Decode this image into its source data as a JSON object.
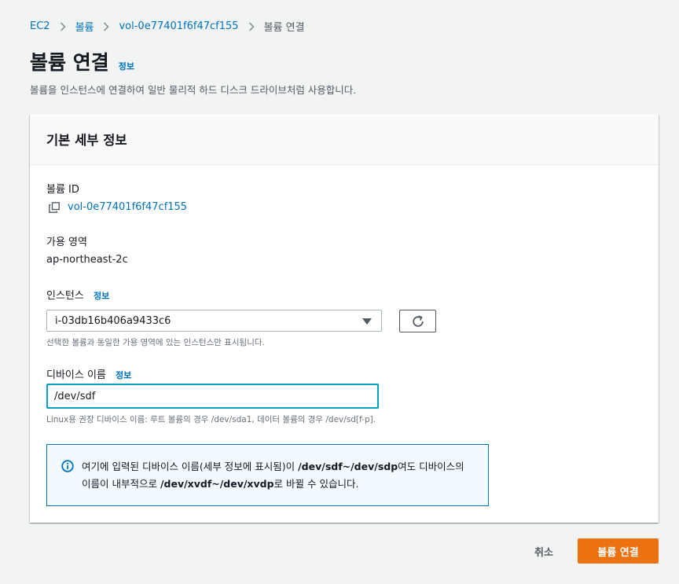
{
  "breadcrumb": {
    "items": [
      "EC2",
      "볼륨",
      "vol-0e77401f6f47cf155"
    ],
    "current": "볼륨 연결"
  },
  "page": {
    "title": "볼륨 연결",
    "info_link": "정보",
    "subtitle": "볼륨을 인스턴스에 연결하여 일반 물리적 하드 디스크 드라이브처럼 사용합니다."
  },
  "panel": {
    "title": "기본 세부 정보",
    "volume_id_label": "볼륨 ID",
    "volume_id_value": "vol-0e77401f6f47cf155",
    "az_label": "가용 영역",
    "az_value": "ap-northeast-2c",
    "instance_label": "인스턴스",
    "instance_info": "정보",
    "instance_selected": "i-03db16b406a9433c6",
    "instance_hint": "선택한 볼륨과 동일한 가용 영역에 있는 인스턴스만 표시됩니다.",
    "device_label": "디바이스 이름",
    "device_info": "정보",
    "device_value": "/dev/sdf",
    "device_hint": "Linux용 권장 디바이스 이름: 루트 볼륨의 경우 /dev/sda1, 데이터 볼륨의 경우 /dev/sd[f-p]."
  },
  "alert": {
    "text_1": "여기에 입력된 디바이스 이름(세부 정보에 표시됨)이 ",
    "bold_1": "/dev/sdf~/dev/sdp",
    "text_2": "여도 디바이스의 이름이 내부적으로 ",
    "bold_2": "/dev/xvdf~/dev/xvdp",
    "text_3": "로 바뀔 수 있습니다."
  },
  "footer": {
    "cancel_label": "취소",
    "submit_label": "볼륨 연결"
  },
  "colors": {
    "accent": "#0073bb",
    "primary_button": "#ec7211",
    "focus_border": "#00a1c9",
    "alert_bg": "#f1faff"
  }
}
